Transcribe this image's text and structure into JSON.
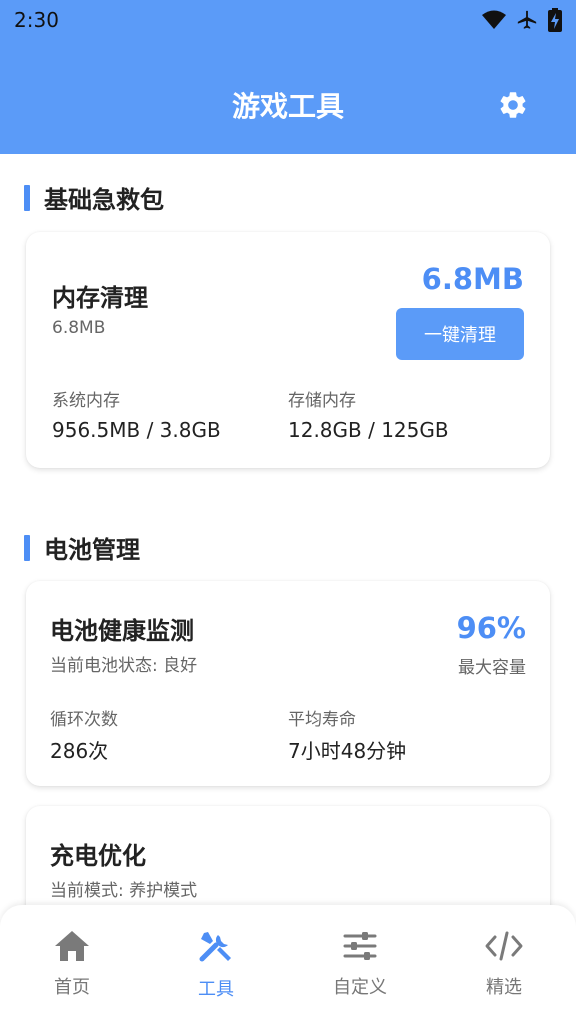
{
  "status_bar": {
    "time": "2:30"
  },
  "header": {
    "title": "游戏工具",
    "settings_icon": "gear-icon"
  },
  "sections": {
    "first_aid": {
      "title": "基础急救包"
    },
    "battery": {
      "title": "电池管理"
    }
  },
  "memory_card": {
    "title": "内存清理",
    "subtitle": "6.8MB",
    "big_value": "6.8MB",
    "clean_button": "一键清理",
    "stats": [
      {
        "label": "系统内存",
        "value": "956.5MB / 3.8GB"
      },
      {
        "label": "存储内存",
        "value": "12.8GB / 125GB"
      }
    ]
  },
  "battery_card": {
    "title": "电池健康监测",
    "subtitle": "当前电池状态: 良好",
    "big_value": "96%",
    "big_label": "最大容量",
    "stats": [
      {
        "label": "循环次数",
        "value": "286次"
      },
      {
        "label": "平均寿命",
        "value": "7小时48分钟"
      }
    ]
  },
  "charge_card": {
    "title": "充电优化",
    "subtitle": "当前模式: 养护模式"
  },
  "bottom_nav": [
    {
      "label": "首页",
      "icon": "home-icon",
      "active": false
    },
    {
      "label": "工具",
      "icon": "tools-icon",
      "active": true
    },
    {
      "label": "自定义",
      "icon": "sliders-icon",
      "active": false
    },
    {
      "label": "精选",
      "icon": "code-icon",
      "active": false
    }
  ],
  "colors": {
    "accent": "#5b9bf8",
    "accent_text": "#4d8ef5"
  }
}
